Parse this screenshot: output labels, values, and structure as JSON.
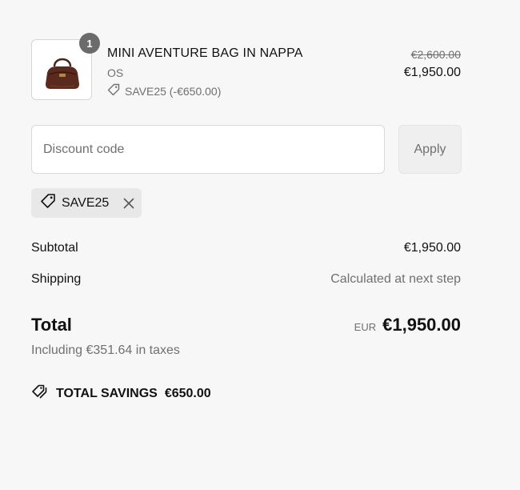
{
  "product": {
    "quantity": "1",
    "title": "MINI AVENTURE BAG IN NAPPA",
    "variant": "OS",
    "discount": "SAVE25 (-€650.00)",
    "price_original": "€2,600.00",
    "price_final": "€1,950.00",
    "icons": {
      "thumbnail": "handbag-image",
      "discount": "tag-icon"
    }
  },
  "discount_form": {
    "placeholder": "Discount code",
    "apply_label": "Apply"
  },
  "applied_code": {
    "code": "SAVE25",
    "icons": {
      "tag": "tag-icon",
      "remove": "close-icon"
    }
  },
  "summary": {
    "subtotal_label": "Subtotal",
    "subtotal_value": "€1,950.00",
    "shipping_label": "Shipping",
    "shipping_value": "Calculated at next step",
    "total_label": "Total",
    "total_currency": "EUR",
    "total_value": "€1,950.00",
    "taxes_note": "Including €351.64 in taxes",
    "savings_label": "TOTAL SAVINGS",
    "savings_value": "€650.00",
    "savings_icon": "tags-icon"
  },
  "colors": {
    "background": "#f7f7f7",
    "muted_text": "#707070",
    "badge": "#6b6b6b",
    "chip": "#e8e8e8"
  }
}
